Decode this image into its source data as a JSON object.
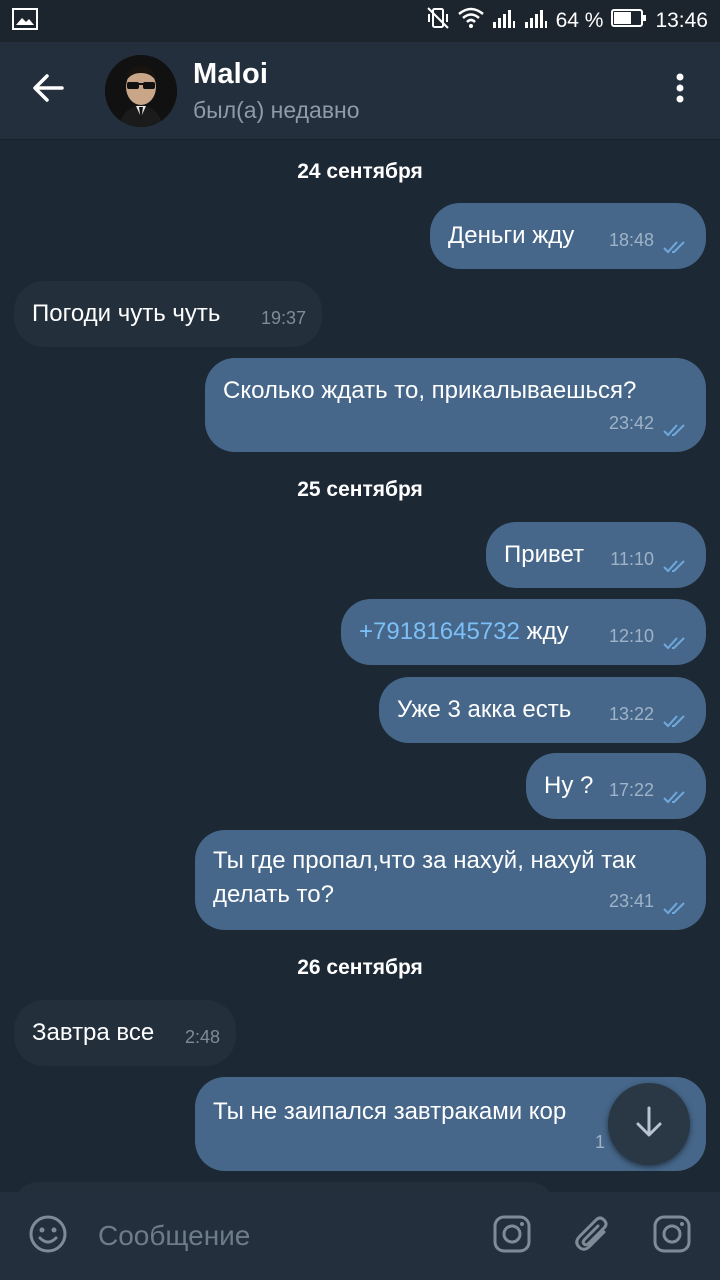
{
  "status_bar": {
    "battery": "64 %",
    "time": "13:46"
  },
  "header": {
    "name": "Maloi",
    "status": "был(а) недавно"
  },
  "chat": {
    "dates": [
      "24 сентября",
      "25 сентября",
      "26 сентября"
    ],
    "messages": [
      {
        "dir": "out",
        "text": "Деньги жду",
        "time": "18:48"
      },
      {
        "dir": "in",
        "text": "Погоди чуть чуть",
        "time": "19:37"
      },
      {
        "dir": "out",
        "text": "Сколько ждать то, прикалываешься?",
        "time": "23:42"
      },
      {
        "dir": "out",
        "text": "Привет",
        "time": "11:10"
      },
      {
        "dir": "out",
        "phone": "+79181645732",
        "text": " жду",
        "time": "12:10"
      },
      {
        "dir": "out",
        "text": "Уже 3 акка есть",
        "time": "13:22"
      },
      {
        "dir": "out",
        "text": "Ну ?",
        "time": "17:22"
      },
      {
        "dir": "out",
        "text_line1": "Ты где пропал,что за нахуй, нахуй так",
        "text_line2": "делать то?",
        "time": "23:41"
      },
      {
        "dir": "in",
        "text": "Завтра все",
        "time": "2:48"
      },
      {
        "dir": "out",
        "text": "Ты не заипался завтраками кор",
        "time": "1"
      }
    ]
  },
  "composer": {
    "placeholder": "Сообщение"
  },
  "colors": {
    "background": "#1c2935",
    "outgoing_bubble": "#46678a",
    "incoming_bubble": "#232f3b",
    "link": "#7cc0f7"
  },
  "icons": [
    "image-icon",
    "vibrate-off-icon",
    "wifi-icon",
    "signal-icon",
    "battery-icon",
    "back-arrow-icon",
    "more-vert-icon",
    "double-check-icon",
    "arrow-down-icon",
    "emoji-icon",
    "instagram-icon",
    "attach-icon"
  ]
}
